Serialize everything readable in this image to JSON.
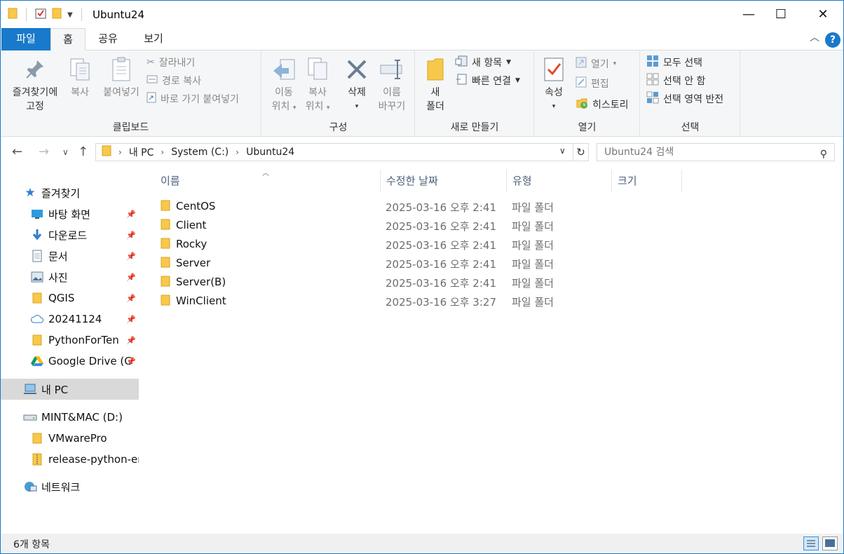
{
  "window": {
    "title": "Ubuntu24",
    "controls": {
      "minimize": "—",
      "maximize": "☐",
      "close": "✕"
    }
  },
  "ribbon_tabs": {
    "file": "파일",
    "home": "홈",
    "share": "공유",
    "view": "보기"
  },
  "ribbon": {
    "clipboard": {
      "label": "클립보드",
      "pin_line1": "즐겨찾기에",
      "pin_line2": "고정",
      "copy": "복사",
      "paste": "붙여넣기",
      "cut": "잘라내기",
      "copy_path": "경로 복사",
      "paste_shortcut": "바로 가기 붙여넣기"
    },
    "organize": {
      "label": "구성",
      "move_line1": "이동",
      "move_line2": "위치",
      "copyto_line1": "복사",
      "copyto_line2": "위치",
      "delete": "삭제",
      "rename_line1": "이름",
      "rename_line2": "바꾸기"
    },
    "new": {
      "label": "새로 만들기",
      "folder_line1": "새",
      "folder_line2": "폴더",
      "new_item": "새 항목",
      "easy_access": "빠른 연결"
    },
    "open": {
      "label": "열기",
      "properties": "속성",
      "open": "열기",
      "edit": "편집",
      "history": "히스토리"
    },
    "select": {
      "label": "선택",
      "select_all": "모두 선택",
      "select_none": "선택 안 함",
      "invert": "선택 영역 반전"
    }
  },
  "address": {
    "segments": [
      "내 PC",
      "System (C:)",
      "Ubuntu24"
    ],
    "search_placeholder": "Ubuntu24 검색"
  },
  "nav": {
    "quick_access": "즐겨찾기",
    "items": [
      {
        "label": "바탕 화면",
        "icon": "desktop-icon"
      },
      {
        "label": "다운로드",
        "icon": "download-icon"
      },
      {
        "label": "문서",
        "icon": "document-icon"
      },
      {
        "label": "사진",
        "icon": "pictures-icon"
      },
      {
        "label": "QGIS",
        "icon": "folder-icon"
      },
      {
        "label": "20241124",
        "icon": "cloud-folder-icon"
      },
      {
        "label": "PythonForTen",
        "icon": "folder-icon"
      },
      {
        "label": "Google Drive (G",
        "icon": "google-drive-icon"
      }
    ],
    "this_pc": "내 PC",
    "drive_d": "MINT&MAC (D:)",
    "drive_children": [
      "VMwarePro",
      "release-python-eml"
    ],
    "network": "네트워크"
  },
  "columns": {
    "name": "이름",
    "date": "수정한 날짜",
    "type": "유형",
    "size": "크기"
  },
  "files": [
    {
      "name": "CentOS",
      "date": "2025-03-16 오후 2:41",
      "type": "파일 폴더"
    },
    {
      "name": "Client",
      "date": "2025-03-16 오후 2:41",
      "type": "파일 폴더"
    },
    {
      "name": "Rocky",
      "date": "2025-03-16 오후 2:41",
      "type": "파일 폴더"
    },
    {
      "name": "Server",
      "date": "2025-03-16 오후 2:41",
      "type": "파일 폴더"
    },
    {
      "name": "Server(B)",
      "date": "2025-03-16 오후 2:41",
      "type": "파일 폴더"
    },
    {
      "name": "WinClient",
      "date": "2025-03-16 오후 3:27",
      "type": "파일 폴더"
    }
  ],
  "status": {
    "count": "6개 항목"
  },
  "colors": {
    "accent": "#1979ca",
    "folder": "#f8c84a",
    "selection": "#d9d9d9"
  }
}
